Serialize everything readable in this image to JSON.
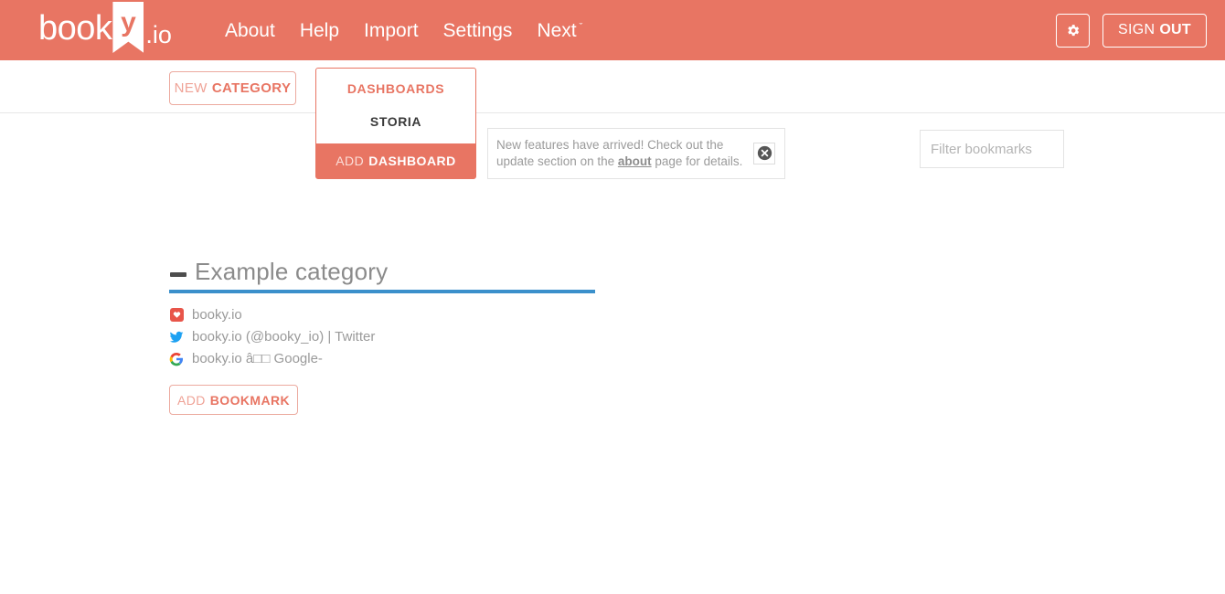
{
  "colors": {
    "brand": "#e87563",
    "brand_border": "#ecaa9f",
    "accent_blue": "#3b90cb",
    "text_muted": "#9a9a9a",
    "divider": "#e6e6e6"
  },
  "header": {
    "logo": {
      "text": "book",
      "mark_letter": "y",
      "suffix": ".io",
      "icon": "bookmark-ribbon-icon"
    },
    "nav": [
      {
        "label": "About",
        "caret": ""
      },
      {
        "label": "Help",
        "caret": ""
      },
      {
        "label": "Import",
        "caret": ""
      },
      {
        "label": "Settings",
        "caret": ""
      },
      {
        "label": "Next",
        "caret": "ˇ"
      }
    ],
    "settings_icon": "gear-icon",
    "sign_out": {
      "light": "SIGN",
      "bold": "OUT"
    }
  },
  "toolbar": {
    "new_category": {
      "light": "NEW",
      "bold": "CATEGORY"
    },
    "dashboards_dropdown": {
      "header": "DASHBOARDS",
      "items": [
        "STORIA"
      ],
      "action": {
        "light": "ADD",
        "bold": "DASHBOARD"
      }
    },
    "notification": {
      "text_before": "New features have arrived! Check out the update section on the ",
      "link": "about",
      "text_after": " page for details.",
      "close_icon": "close-circle-icon"
    },
    "filter": {
      "placeholder": "Filter bookmarks",
      "value": ""
    }
  },
  "main": {
    "category": {
      "title": "Example category",
      "collapse_icon": "minus-icon",
      "bookmarks": [
        {
          "label": "booky.io",
          "icon": "booky-favicon"
        },
        {
          "label": "booky.io (@booky_io) | Twitter",
          "icon": "twitter-favicon"
        },
        {
          "label": "booky.io â□□ Google-",
          "icon": "google-favicon"
        }
      ],
      "add_bookmark": {
        "light": "ADD",
        "bold": "BOOKMARK"
      }
    }
  }
}
